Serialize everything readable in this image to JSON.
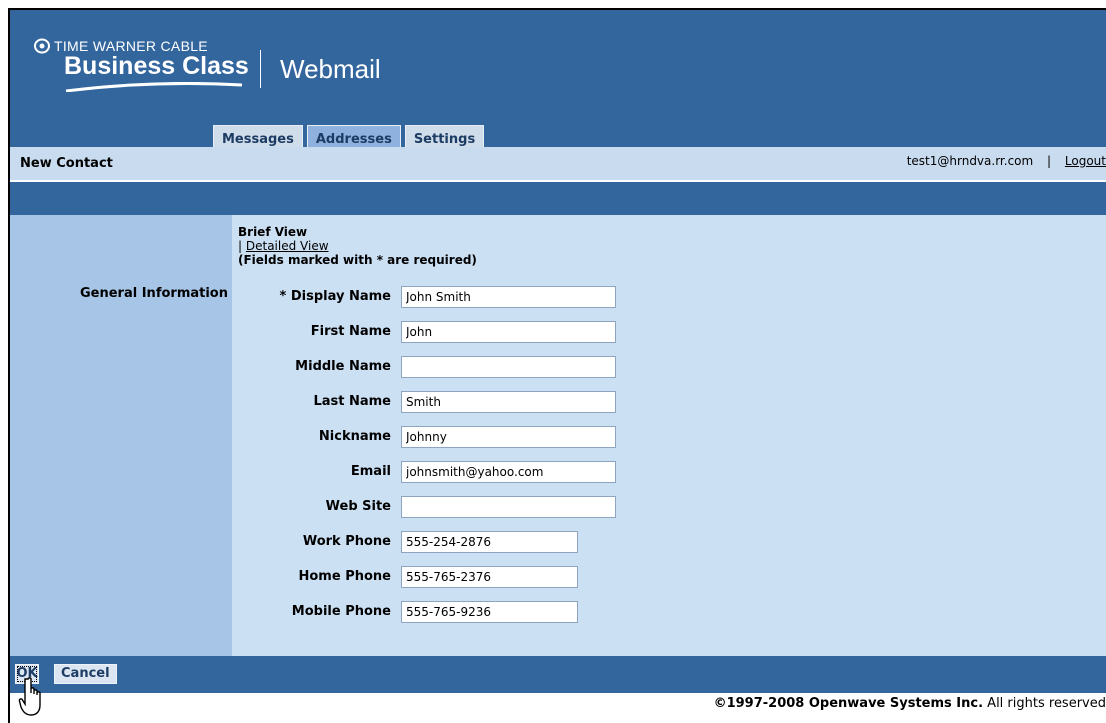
{
  "header": {
    "brand_top": "TIME WARNER CABLE",
    "brand_main": "Business Class",
    "app_title": "Webmail"
  },
  "tabs": [
    {
      "label": "Messages",
      "active": false
    },
    {
      "label": "Addresses",
      "active": true
    },
    {
      "label": "Settings",
      "active": false
    }
  ],
  "subbar": {
    "title": "New Contact",
    "user_email": "test1@hrndva.rr.com",
    "separator": "|",
    "logout_label": "Logout"
  },
  "form": {
    "section_label": "General Information",
    "brief_view": "Brief View",
    "view_separator": "|",
    "detailed_view": "Detailed View",
    "required_note": "(Fields marked with * are required)",
    "fields": [
      {
        "label": "* Display Name",
        "value": "John Smith"
      },
      {
        "label": "First Name",
        "value": "John"
      },
      {
        "label": "Middle Name",
        "value": ""
      },
      {
        "label": "Last Name",
        "value": "Smith"
      },
      {
        "label": "Nickname",
        "value": "Johnny"
      },
      {
        "label": "Email",
        "value": "johnsmith@yahoo.com"
      },
      {
        "label": "Web Site",
        "value": ""
      },
      {
        "label": "Work Phone",
        "value": "555-254-2876"
      },
      {
        "label": "Home Phone",
        "value": "555-765-2376"
      },
      {
        "label": "Mobile Phone",
        "value": "555-765-9236"
      }
    ]
  },
  "footer": {
    "ok_label": "OK",
    "cancel_label": "Cancel",
    "copyright_bold": "©1997-2008 Openwave Systems Inc.",
    "copyright_rest": " All rights reserved"
  },
  "colors": {
    "header_blue": "#34669e",
    "light_blue": "#cce0f4",
    "side_blue": "#a7c5e6"
  }
}
